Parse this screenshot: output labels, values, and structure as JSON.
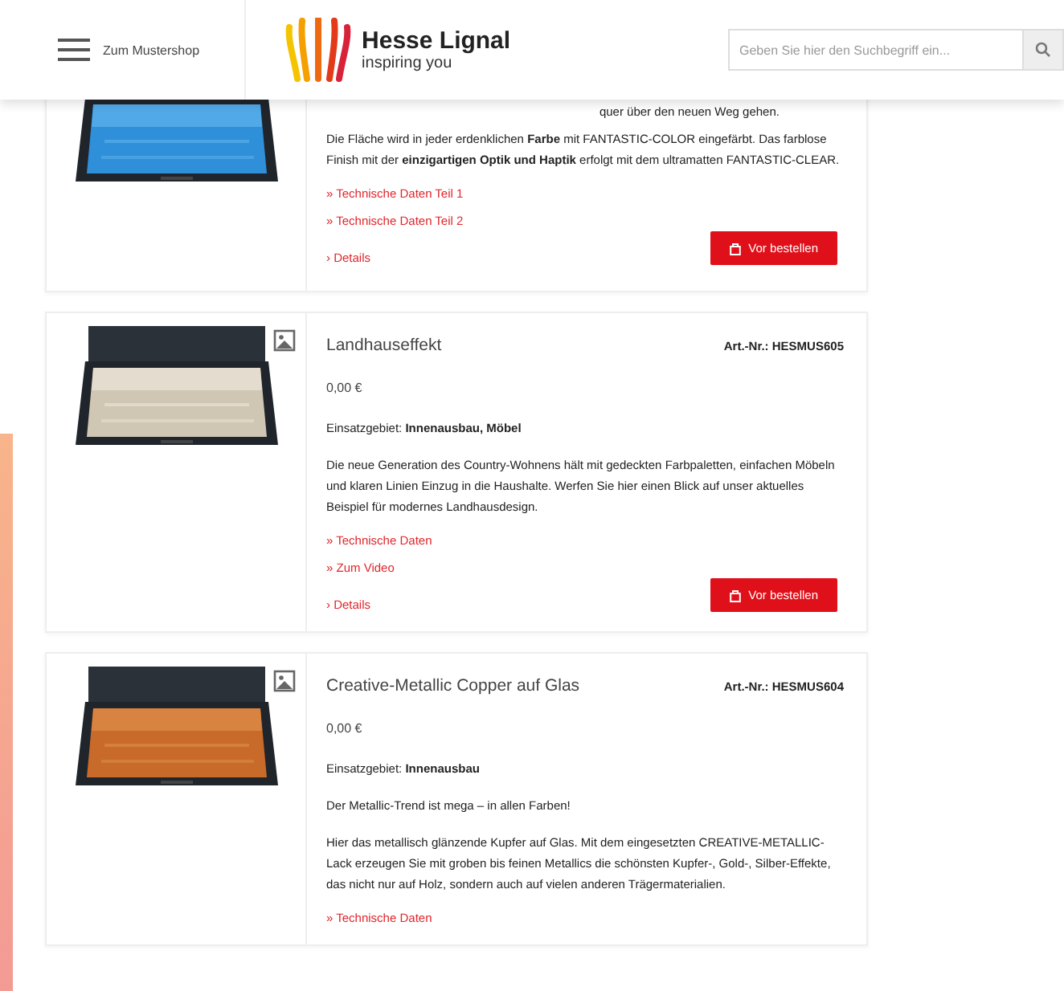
{
  "header": {
    "menu_label": "Zum Mustershop",
    "logo_name": "Hesse Lignal",
    "logo_tagline": "inspiring you",
    "search": {
      "placeholder": "Geben Sie hier den Suchbegriff ein..."
    }
  },
  "products": [
    {
      "intro": "quer über den neuen Weg gehen.",
      "description": "Die Fläche wird in jeder erdenklichen **Farbe** mit FANTASTIC-COLOR eingefärbt. Das farblose Finish mit der **einzigartigen Optik und Haptik** erfolgt mit dem ultramatten FANTASTIC-CLEAR.",
      "links": [
        "» Technische Daten Teil 1",
        "» Technische Daten Teil 2"
      ],
      "details": "› Details",
      "button": "Vor bestellen"
    },
    {
      "name": "Landhauseffekt",
      "art_nr": "Art.-Nr.: HESMUS605",
      "price": "0,00 €",
      "usage": "Einsatzgebiet: **Innenausbau, Möbel**",
      "description": "Die neue Generation des Country-Wohnens hält mit gedeckten Farbpaletten, einfachen Möbeln und klaren Linien Einzug in die Haushalte. Werfen Sie hier einen Blick auf unser aktuelles Beispiel für modernes Landhausdesign.",
      "links": [
        "» Technische Daten",
        "» Zum Video"
      ],
      "details": "› Details",
      "button": "Vor bestellen"
    },
    {
      "name": "Creative-Metallic Copper auf Glas",
      "art_nr": "Art.-Nr.: HESMUS604",
      "price": "0,00 €",
      "usage": "Einsatzgebiet: **Innenausbau**",
      "headline": "Der Metallic-Trend ist mega – in allen Farben!",
      "description": "Hier das metallisch glänzende Kupfer auf Glas. Mit dem eingesetzten CREATIVE-METALLIC-Lack erzeugen Sie mit groben bis feinen Metallics die schönsten Kupfer-, Gold-, Silber-Effekte, das nicht nur auf Holz, sondern auch auf vielen anderen Trägermaterialien.",
      "links": [
        "» Technische Daten"
      ]
    }
  ]
}
